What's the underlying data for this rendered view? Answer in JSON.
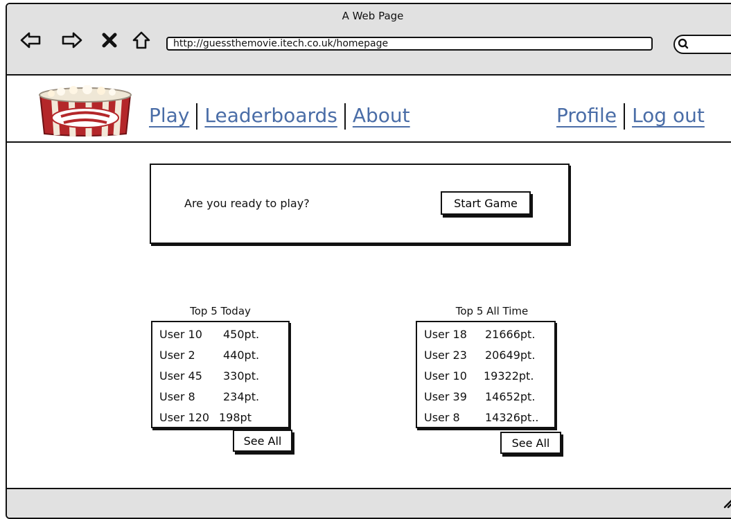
{
  "browser": {
    "window_title": "A Web Page",
    "url": "http://guessthemovie.itech.co.uk/homepage",
    "nav_icons": [
      "back-arrow-icon",
      "forward-arrow-icon",
      "close-icon",
      "home-icon"
    ],
    "search_icon": "search-icon"
  },
  "site": {
    "logo_icon": "guess-the-movie-logo-icon",
    "nav_left": [
      "Play",
      "Leaderboards",
      "About"
    ],
    "nav_right": [
      "Profile",
      "Log out"
    ],
    "link_color": "#4a6da7"
  },
  "play": {
    "prompt": "Are you ready to play?",
    "start_label": "Start Game"
  },
  "leaderboards": {
    "today": {
      "title": "Top 5 Today",
      "rows": [
        {
          "user": "User 10",
          "score": "450pt."
        },
        {
          "user": "User 2",
          "score": "440pt."
        },
        {
          "user": "User 45",
          "score": "330pt."
        },
        {
          "user": "User 8",
          "score": "234pt."
        },
        {
          "user": "User 120",
          "score": "198pt"
        }
      ],
      "see_all_label": "See All"
    },
    "all_time": {
      "title": "Top 5 All Time",
      "rows": [
        {
          "user": "User 18",
          "score": "21666pt."
        },
        {
          "user": "User 23",
          "score": "20649pt."
        },
        {
          "user": "User 10",
          "score": "19322pt."
        },
        {
          "user": "User 39",
          "score": "14652pt."
        },
        {
          "user": "User 8",
          "score": "14326pt.."
        }
      ],
      "see_all_label": "See All"
    }
  }
}
